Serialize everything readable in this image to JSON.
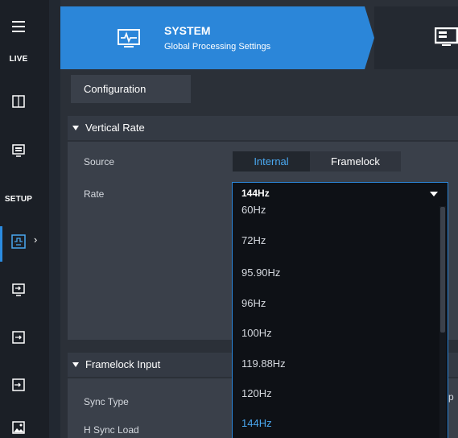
{
  "sidebar": {
    "menu_icon": "hamburger-icon",
    "live_label": "LIVE",
    "setup_label": "SETUP",
    "chevron": "›"
  },
  "banner": {
    "title": "SYSTEM",
    "subtitle": "Global Processing Settings"
  },
  "tabs": [
    {
      "label": "Configuration"
    }
  ],
  "vertical_rate": {
    "header": "Vertical Rate",
    "source_label": "Source",
    "source_options": [
      "Internal",
      "Framelock"
    ],
    "source_selected": "Internal",
    "rate_label": "Rate",
    "rate_value": "144Hz",
    "rate_options": [
      "60Hz",
      "72Hz",
      "95.90Hz",
      "96Hz",
      "100Hz",
      "119.88Hz",
      "120Hz",
      "144Hz"
    ]
  },
  "framelock_input": {
    "header": "Framelock Input",
    "sync_type_label": "Sync Type",
    "h_sync_load_label": "H Sync Load",
    "partial_value": "p"
  },
  "colors": {
    "accent": "#2b86d9",
    "selected_text": "#4aa8f0"
  }
}
